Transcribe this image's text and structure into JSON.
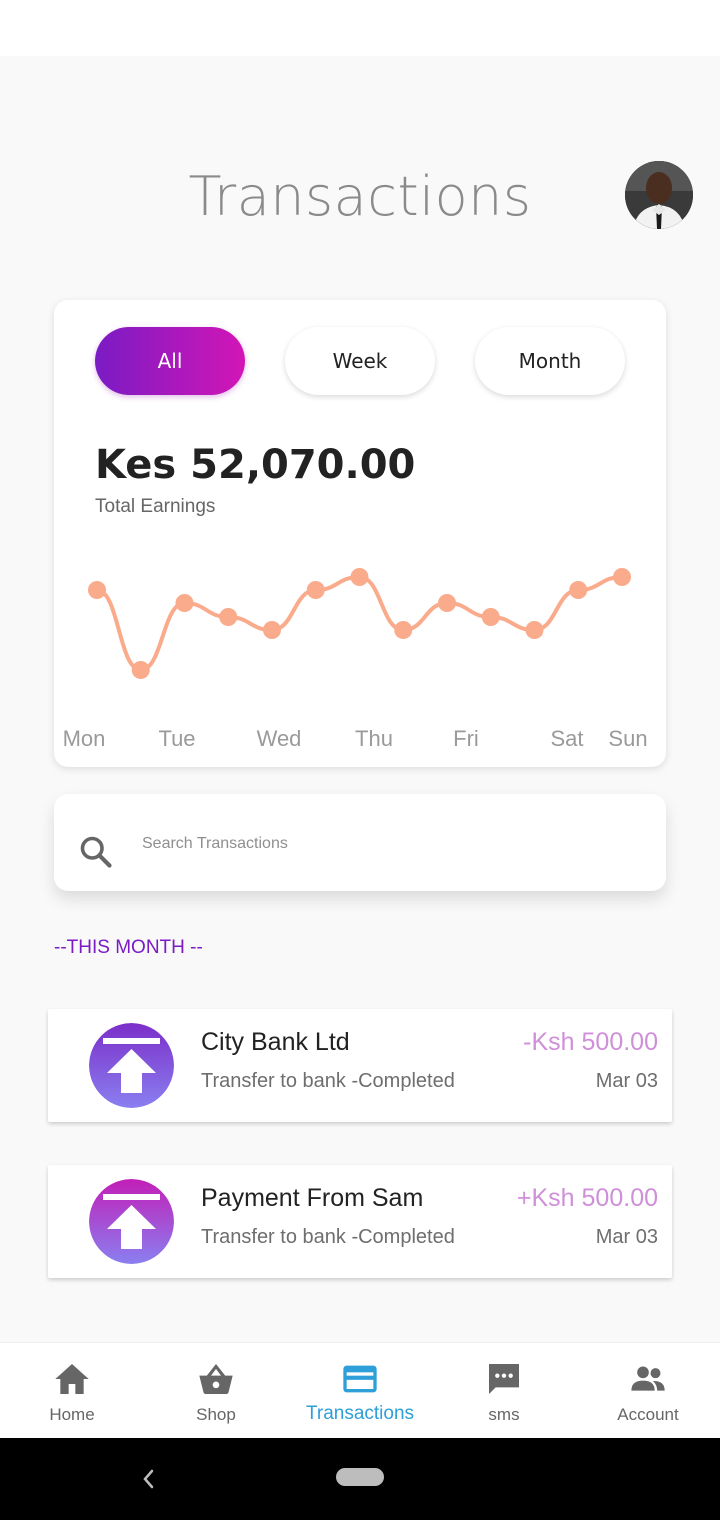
{
  "header": {
    "title": "Transactions"
  },
  "filters": [
    {
      "label": "All",
      "active": true
    },
    {
      "label": "Week",
      "active": false
    },
    {
      "label": "Month",
      "active": false
    }
  ],
  "earnings": {
    "amount": "Kes 52,070.00",
    "label": "Total Earnings"
  },
  "chart_data": {
    "type": "line",
    "x_labels": [
      "Mon",
      "Tue",
      "Wed",
      "Thu",
      "Fri",
      "Sat",
      "Sun"
    ],
    "series": [
      {
        "values": [
          0.8,
          0.0,
          0.67,
          0.53,
          0.4,
          0.8,
          0.93,
          0.4,
          0.67,
          0.53,
          0.4,
          0.8,
          0.93
        ]
      }
    ],
    "color": "#f9ab8b",
    "grid": false
  },
  "search": {
    "placeholder": "Search Transactions"
  },
  "section": {
    "label": "--THIS MONTH --"
  },
  "transactions": [
    {
      "name": "City Bank Ltd",
      "description": "Transfer to bank -Completed",
      "amount": "-Ksh 500.00",
      "date": "Mar 03",
      "icon": "upload-icon",
      "gradient": [
        "#7b2fc9",
        "#8a7ff0"
      ]
    },
    {
      "name": "Payment From Sam",
      "description": "Transfer to bank -Completed",
      "amount": "+Ksh 500.00",
      "date": "Mar 03",
      "icon": "upload-icon",
      "gradient": [
        "#c21fb7",
        "#8a7ff0"
      ]
    }
  ],
  "nav": [
    {
      "label": "Home",
      "icon": "home-icon"
    },
    {
      "label": "Shop",
      "icon": "basket-icon"
    },
    {
      "label": "Transactions",
      "icon": "card-icon",
      "active": true
    },
    {
      "label": "sms",
      "icon": "chat-icon"
    },
    {
      "label": "Account",
      "icon": "people-icon"
    }
  ],
  "colors": {
    "accent": "#2e9fd8",
    "purple": "#7a1bc4",
    "magenta": "#d316b6",
    "chart_line": "#f9ab8b",
    "amount": "#cf8fd9"
  }
}
